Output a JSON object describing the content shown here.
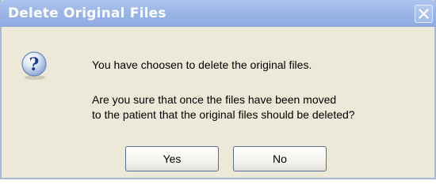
{
  "dialog": {
    "title": "Delete Original Files",
    "icon": "question-icon",
    "message_line1": "You have choosen to delete the original files.",
    "message_line2": "Are you sure that once the files have been moved",
    "message_line3": "to the patient that the original files should be deleted?",
    "buttons": {
      "yes": "Yes",
      "no": "No"
    }
  },
  "colors": {
    "titlebar": "#9db7e8",
    "window_background": "#ece9d8",
    "title_text": "#ffffff"
  }
}
